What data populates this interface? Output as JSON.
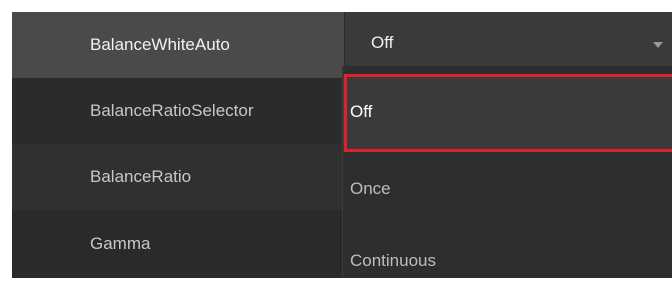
{
  "properties": [
    {
      "name": "BalanceWhiteAuto"
    },
    {
      "name": "BalanceRatioSelector"
    },
    {
      "name": "BalanceRatio"
    },
    {
      "name": "Gamma"
    }
  ],
  "combo": {
    "value": "Off",
    "arrow_icon": "caret-down-icon"
  },
  "dropdown": {
    "options": [
      "Off",
      "Once",
      "Continuous"
    ],
    "selected": "Off"
  },
  "colors": {
    "highlight_border": "#e0202a",
    "grid_background": "#262626",
    "selected_option_bg": "#3b3b3b"
  }
}
